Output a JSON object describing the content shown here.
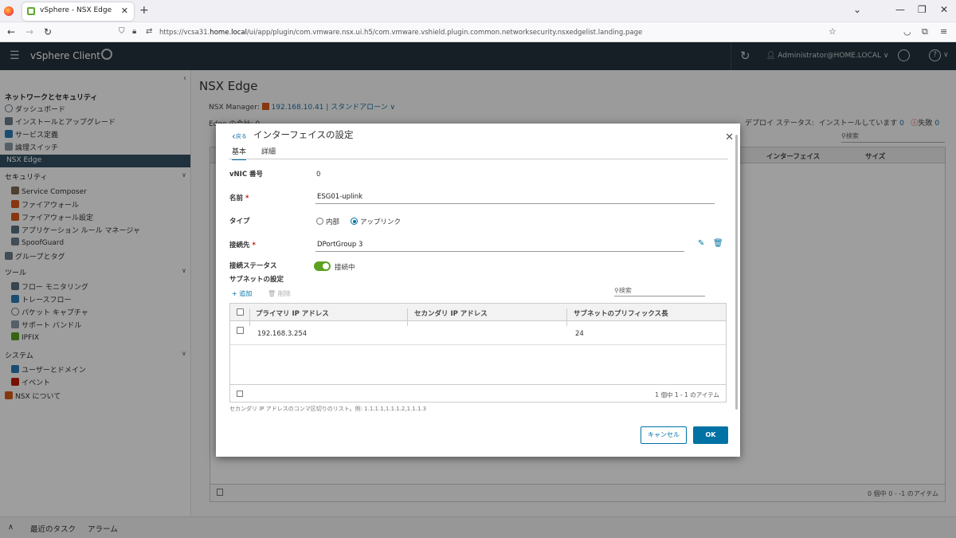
{
  "browser": {
    "tab_title": "vSphere - NSX Edge",
    "tab_close": "✕",
    "new_tab": "+",
    "url_host": "https://vcsa31.",
    "url_domain": "home.local",
    "url_path": "/ui/app/plugin/com.vmware.nsx.ui.h5/com.vmware.vshield.plugin.common.networksecurity.nsxedgelist.landing.page"
  },
  "header": {
    "brand": "vSphere Client",
    "user": "Administrator@HOME.LOCAL ∨",
    "help": "?"
  },
  "sidebar": {
    "section_title": "ネットワークとセキュリティ",
    "items_top": [
      "ダッシュボード",
      "インストールとアップグレード",
      "サービス定義",
      "論理スイッチ"
    ],
    "active_item": "NSX Edge",
    "group_security": "セキュリティ",
    "security_items": [
      "Service Composer",
      "ファイアウォール",
      "ファイアウォール設定",
      "アプリケーション ルール マネージャ",
      "SpoofGuard"
    ],
    "groups_tags": "グループとタグ",
    "group_tools": "ツール",
    "tools_items": [
      "フロー モニタリング",
      "トレースフロー",
      "パケット キャプチャ",
      "サポート バンドル",
      "IPFIX"
    ],
    "group_system": "システム",
    "system_items": [
      "ユーザーとドメイン",
      "イベント"
    ],
    "about": "NSX について"
  },
  "main": {
    "title": "NSX Edge",
    "manager_label": "NSX Manager:",
    "manager_value": "192.168.10.41 | スタンドアローン ∨",
    "edge_count": "Edge の合計: 0",
    "deploy_label": "デプロイ ステータス:",
    "deploy_installing": "インストールしています",
    "deploy_installing_count": "0",
    "deploy_failed": "失敗",
    "deploy_failed_count": "0",
    "search_placeholder": "検索",
    "col_interface": "インターフェイス",
    "col_size": "サイズ",
    "pager": "0 個中 0 - -1 のアイテム"
  },
  "bottombar": {
    "recent_tasks": "最近のタスク",
    "alarms": "アラーム"
  },
  "dialog": {
    "back": "戻る",
    "title": "インターフェイスの設定",
    "tab_basic": "基本",
    "tab_detail": "詳細",
    "vnic_label": "vNIC 番号",
    "vnic_value": "0",
    "name_label": "名前",
    "name_value": "ESG01-uplink",
    "type_label": "タイプ",
    "type_internal": "内部",
    "type_uplink": "アップリンク",
    "connect_label": "接続先",
    "connect_value": "DPortGroup 3",
    "status_label": "接続ステータス",
    "status_value": "接続中",
    "subnet_label": "サブネットの設定",
    "add": "追加",
    "delete": "削除",
    "search_placeholder": "検索",
    "col_primary": "プライマリ IP アドレス",
    "col_secondary": "セカンダリ IP アドレス",
    "col_prefix": "サブネットのプリフィックス長",
    "rows": [
      {
        "primary": "192.168.3.254",
        "secondary": "",
        "prefix": "24"
      }
    ],
    "pager": "1 個中 1 - 1 のアイテム",
    "hint": "セカンダリ IP アドレスのコンマ区切りのリスト。例: 1.1.1.1,1.1.1.2,1.1.1.3",
    "cancel": "キャンセル",
    "ok": "OK"
  }
}
